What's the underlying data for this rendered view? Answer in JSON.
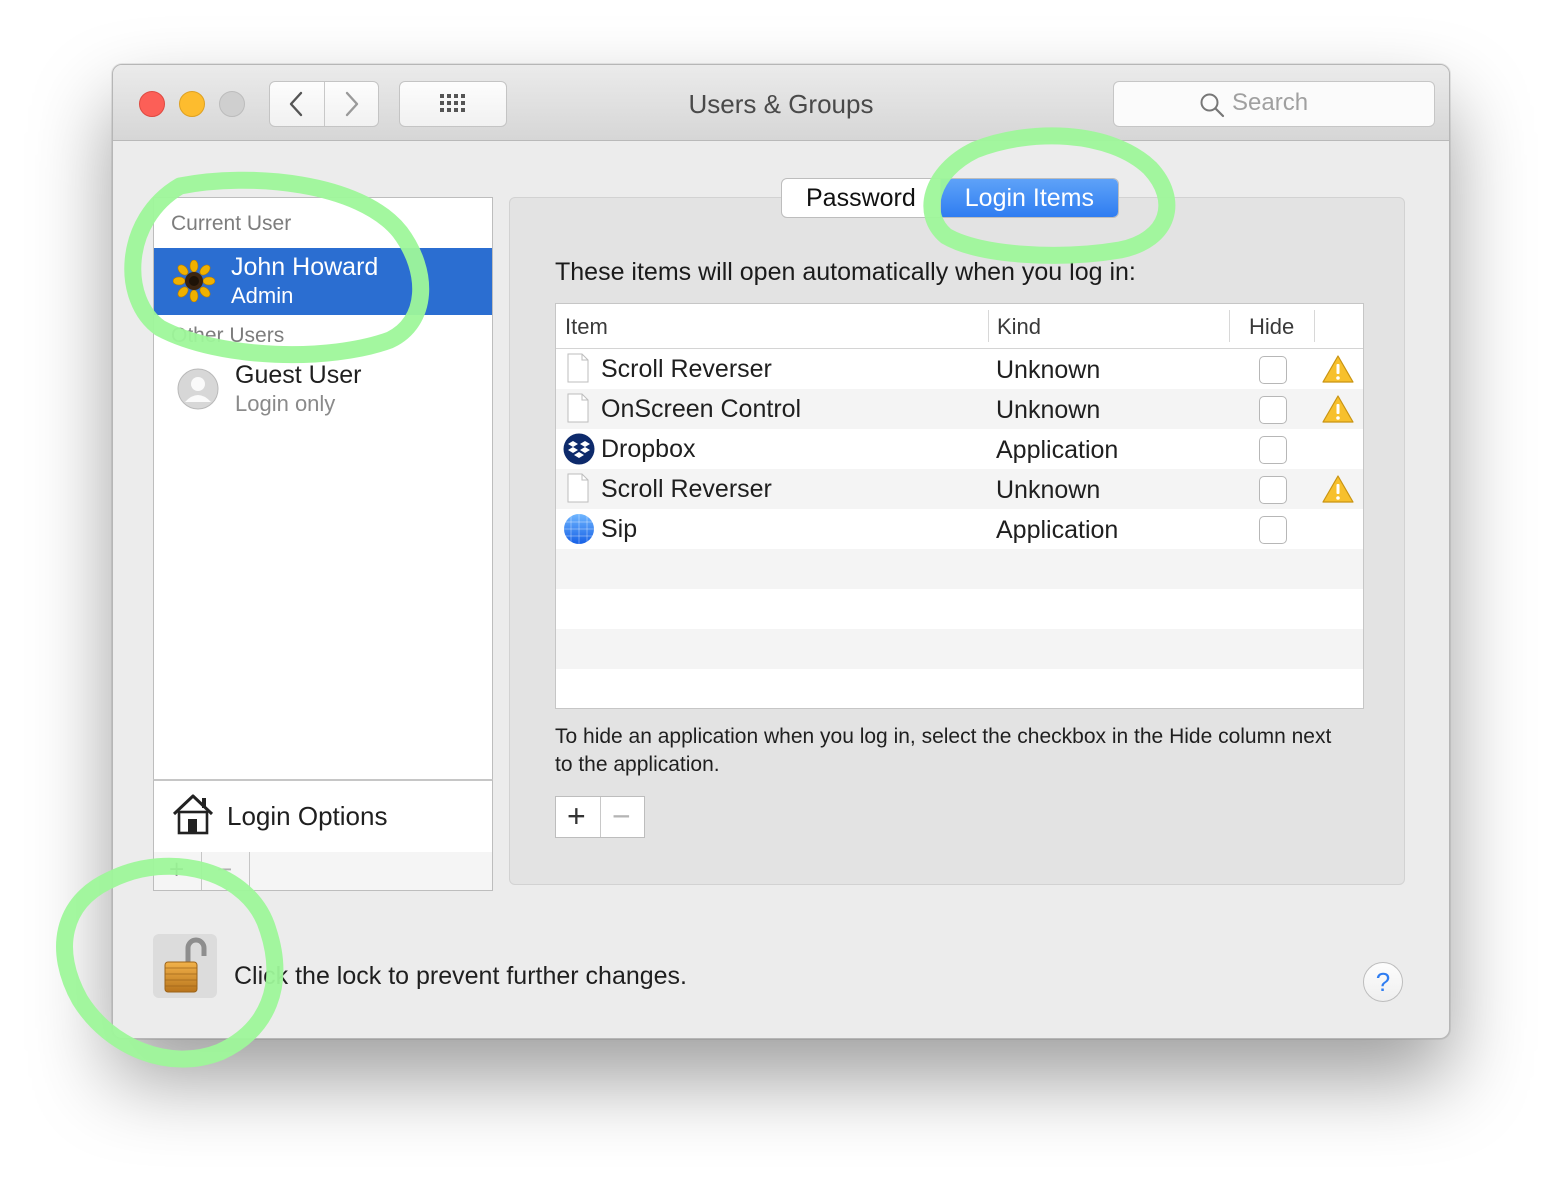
{
  "window": {
    "title": "Users & Groups",
    "search_placeholder": "Search"
  },
  "users_panel": {
    "current_user_header": "Current User",
    "current_user": {
      "name": "John Howard",
      "role": "Admin"
    },
    "other_users_header": "Other Users",
    "other_users": [
      {
        "name": "Guest User",
        "role": "Login only"
      }
    ],
    "login_options_label": "Login Options",
    "add_button": "+",
    "remove_button": "−"
  },
  "tabs": [
    {
      "label": "Password",
      "selected": false
    },
    {
      "label": "Login Items",
      "selected": true
    }
  ],
  "login_items": {
    "intro": "These items will open automatically when you log in:",
    "columns": {
      "item": "Item",
      "kind": "Kind",
      "hide": "Hide"
    },
    "rows": [
      {
        "name": "Scroll Reverser",
        "kind": "Unknown",
        "hide": false,
        "warning": true,
        "icon": "generic-file-icon"
      },
      {
        "name": "OnScreen Control",
        "kind": "Unknown",
        "hide": false,
        "warning": true,
        "icon": "generic-file-icon"
      },
      {
        "name": "Dropbox",
        "kind": "Application",
        "hide": false,
        "warning": false,
        "icon": "dropbox-icon"
      },
      {
        "name": "Scroll Reverser",
        "kind": "Unknown",
        "hide": false,
        "warning": true,
        "icon": "generic-file-icon"
      },
      {
        "name": "Sip",
        "kind": "Application",
        "hide": false,
        "warning": false,
        "icon": "sip-icon"
      }
    ],
    "note": "To hide an application when you log in, select the checkbox in the Hide column next to the application.",
    "add_button": "+",
    "remove_button": "−"
  },
  "footer": {
    "lock_text": "Click the lock to prevent further changes.",
    "help_label": "?"
  },
  "colors": {
    "selection": "#2b6ed1",
    "accent": "#2f7df1",
    "annotation_marker": "#9ef79a"
  }
}
